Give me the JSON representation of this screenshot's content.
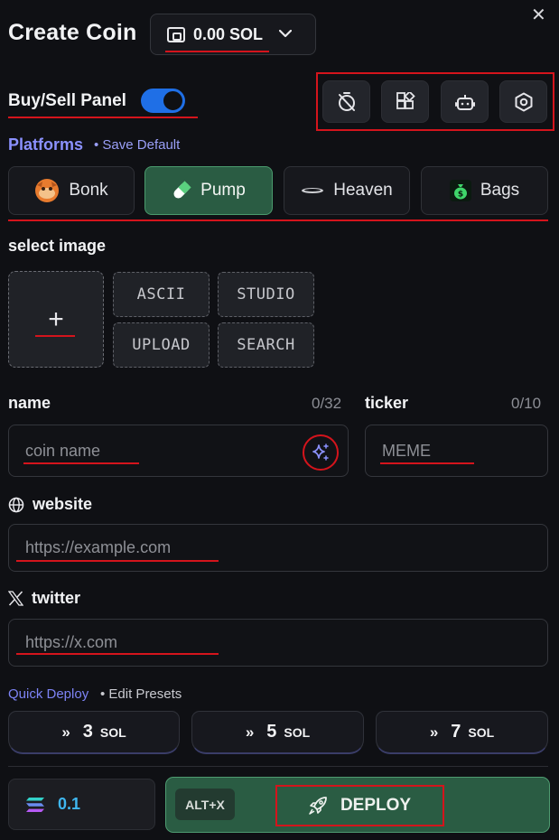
{
  "header": {
    "title": "Create Coin",
    "wallet_balance": "0.00 SOL",
    "close_glyph": "✕"
  },
  "panel": {
    "buy_sell_label": "Buy/Sell Panel",
    "buy_sell_enabled": true,
    "tool_icons": [
      "timer-off-icon",
      "widgets-icon",
      "bot-icon",
      "settings-hexagon-icon"
    ]
  },
  "platforms": {
    "label": "Platforms",
    "save_default": "• Save Default",
    "items": [
      {
        "label": "Bonk",
        "icon": "bonk-dog-icon",
        "active": false
      },
      {
        "label": "Pump",
        "icon": "pill-icon",
        "active": true
      },
      {
        "label": "Heaven",
        "icon": "halo-icon",
        "active": false
      },
      {
        "label": "Bags",
        "icon": "money-bag-icon",
        "active": false
      }
    ]
  },
  "image": {
    "label": "select image",
    "add_glyph": "+",
    "buttons": [
      "ASCII",
      "STUDIO",
      "UPLOAD",
      "SEARCH"
    ]
  },
  "name_field": {
    "label": "name",
    "count": "0/32",
    "placeholder": "coin name"
  },
  "ticker_field": {
    "label": "ticker",
    "count": "0/10",
    "placeholder": "MEME"
  },
  "website_field": {
    "label": "website",
    "placeholder": "https://example.com"
  },
  "twitter_field": {
    "label": "twitter",
    "placeholder": "https://x.com"
  },
  "quick_deploy": {
    "label": "Quick Deploy",
    "edit_presets": "• Edit Presets",
    "presets": [
      {
        "arrows": "»",
        "amount": "3",
        "unit": "SOL"
      },
      {
        "arrows": "»",
        "amount": "5",
        "unit": "SOL"
      },
      {
        "arrows": "»",
        "amount": "7",
        "unit": "SOL"
      }
    ]
  },
  "deploy": {
    "amount": "0.1",
    "hotkey": "ALT+X",
    "label": "DEPLOY"
  },
  "colors": {
    "accent_blue": "#1f6fe6",
    "accent_green": "#2a5c43",
    "link_purple": "#8b91ff",
    "annotation_red": "#d4141c"
  }
}
